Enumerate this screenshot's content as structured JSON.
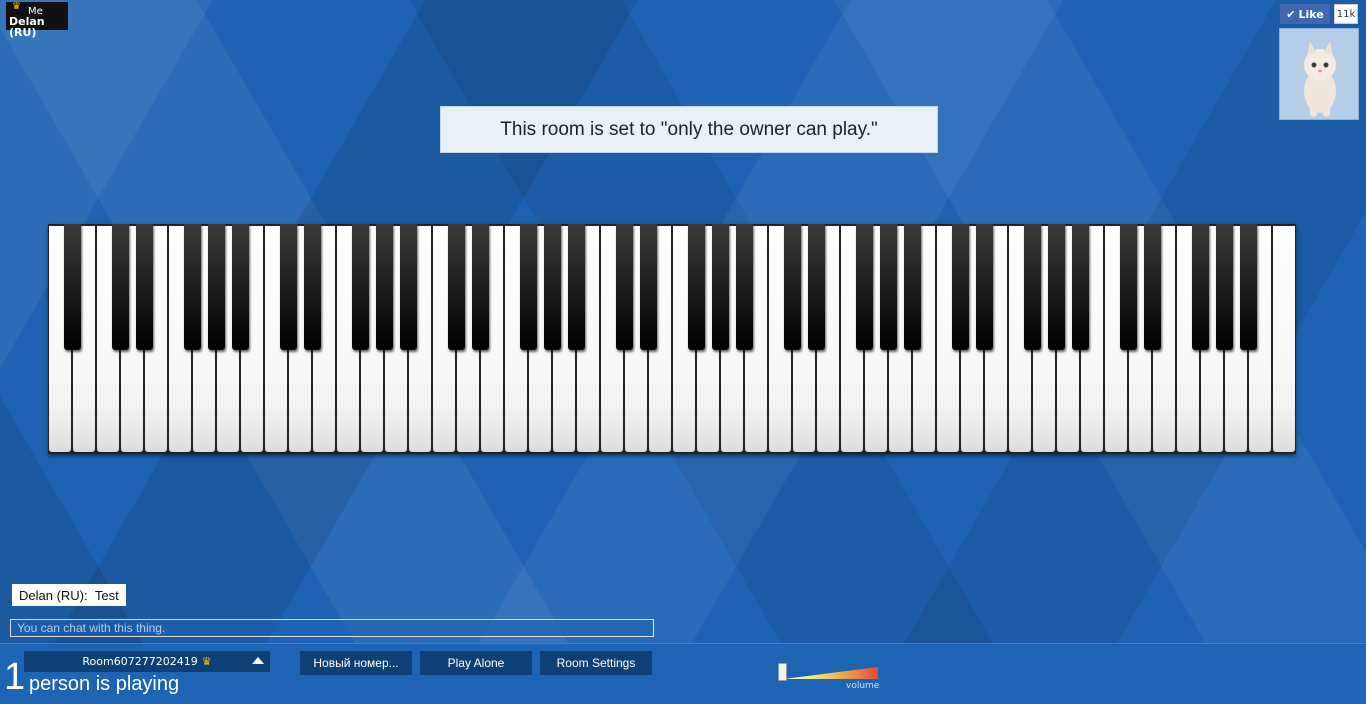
{
  "user": {
    "me_label": "Me",
    "name": "Delan (RU)"
  },
  "social": {
    "like_label": "Like",
    "like_count": "11k"
  },
  "notice": {
    "text": "This room is set to \"only the owner can play.\""
  },
  "piano": {
    "white_keys": 52,
    "black_keys": 36
  },
  "chat": {
    "messages": [
      {
        "author": "Delan (RU):",
        "text": "Test"
      }
    ],
    "input_placeholder": "You can chat with this thing."
  },
  "bottom": {
    "room_name": "Room607277202419",
    "player_count": "1",
    "player_label": "person is playing",
    "buttons": {
      "new_room": "Новый номер...",
      "play_alone": "Play Alone",
      "room_settings": "Room Settings"
    },
    "volume_label": "volume",
    "volume_level": 0.0
  },
  "colors": {
    "background": "#1e63b3",
    "bar": "#1d65b2",
    "button": "#0e3f75"
  }
}
